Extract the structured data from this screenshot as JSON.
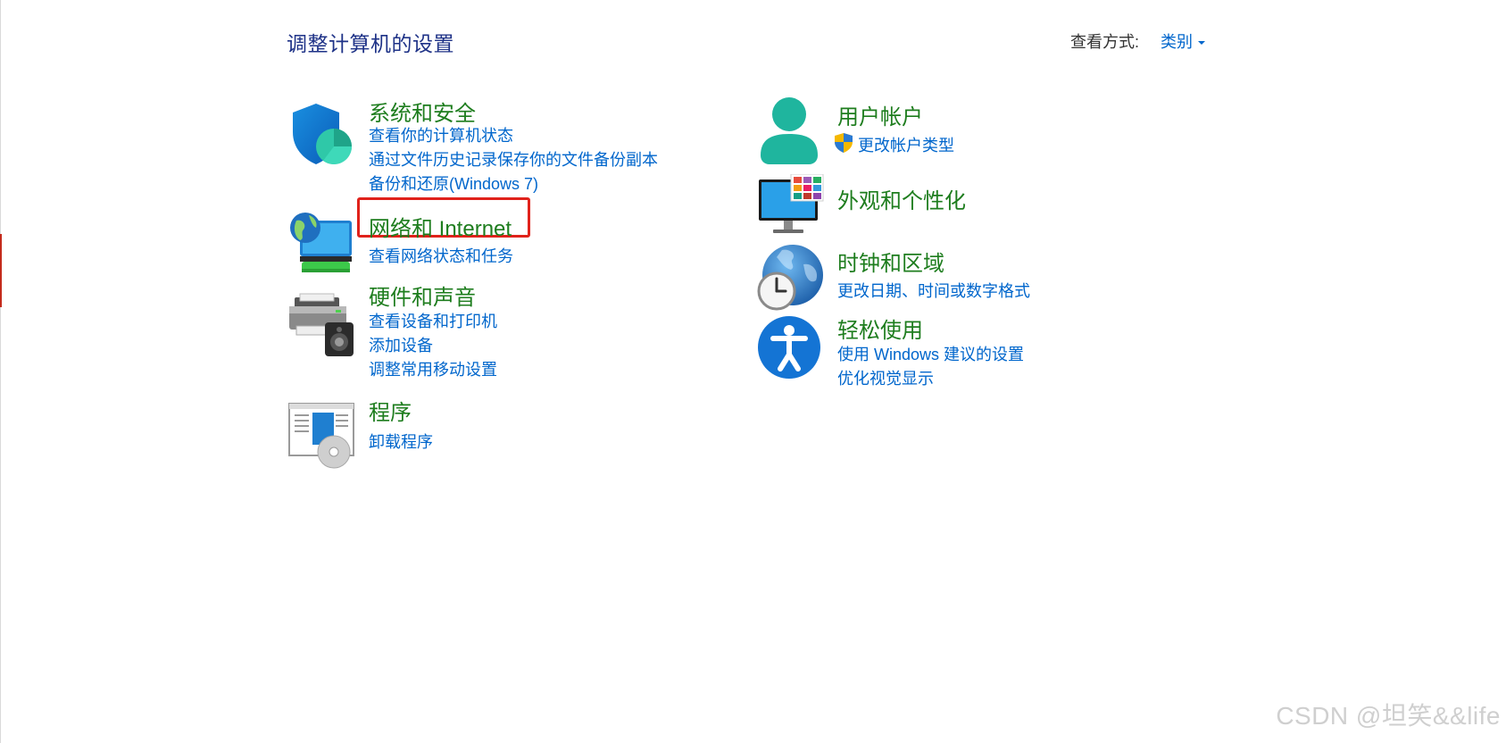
{
  "header": {
    "title": "调整计算机的设置",
    "view_by_label": "查看方式:",
    "view_by_value": "类别"
  },
  "categories": [
    {
      "title": "系统和安全",
      "icon": "shield-icon",
      "links": [
        "查看你的计算机状态",
        "通过文件历史记录保存你的文件备份副本",
        "备份和还原(Windows 7)"
      ]
    },
    {
      "title": "网络和 Internet",
      "icon": "network-globe-icon",
      "links": [
        "查看网络状态和任务"
      ],
      "highlighted": true
    },
    {
      "title": "硬件和声音",
      "icon": "printer-speaker-icon",
      "links": [
        "查看设备和打印机",
        "添加设备",
        "调整常用移动设置"
      ]
    },
    {
      "title": "程序",
      "icon": "programs-disc-icon",
      "links": [
        "卸载程序"
      ]
    },
    {
      "title": "用户帐户",
      "icon": "user-icon",
      "links": [
        "更改帐户类型"
      ]
    },
    {
      "title": "外观和个性化",
      "icon": "monitor-personalize-icon",
      "links": []
    },
    {
      "title": "时钟和区域",
      "icon": "globe-clock-icon",
      "links": [
        "更改日期、时间或数字格式"
      ]
    },
    {
      "title": "轻松使用",
      "icon": "accessibility-icon",
      "links": [
        "使用 Windows 建议的设置",
        "优化视觉显示"
      ]
    }
  ],
  "watermark": "CSDN @坦笑&&life",
  "colors": {
    "title_blue": "#1e3287",
    "category_green": "#1e7d1e",
    "link_blue": "#0066cc",
    "highlight_red": "#e0221b"
  }
}
